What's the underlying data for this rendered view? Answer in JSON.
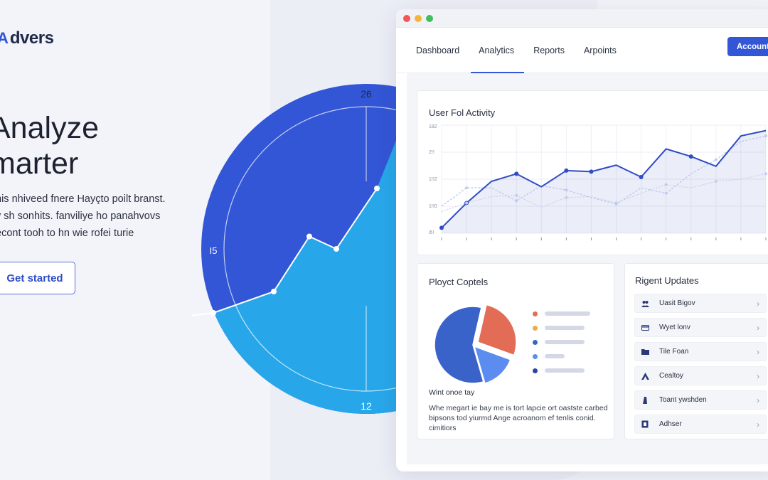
{
  "brand": {
    "logo_mark": "A",
    "logo_text": "dvers"
  },
  "hero": {
    "title_line1": "Analyze",
    "title_line2": "marter",
    "desc_lines": [
      "nis nhiveed fnere Hayçto poilt branst.",
      "y sh sonhits. fanviliye ho panahvovs",
      "econt tooh to hn wie rofei turie"
    ],
    "cta_label": "Get started"
  },
  "gauge": {
    "label_top": "26",
    "label_left": "I5",
    "label_bottom": "12",
    "line_values": [
      0.12,
      0.24,
      0.55,
      0.48,
      0.82
    ]
  },
  "window": {
    "nav_tabs": [
      "Dashboard",
      "Analytics",
      "Reports",
      "Arpoints"
    ],
    "active_tab": "Analytics",
    "account_label": "Account",
    "activity": {
      "title": "User Fol Activity",
      "y_labels": [
        "182",
        "2!!",
        "1!!2",
        "1!!0",
        "i5!"
      ],
      "chart_data": {
        "type": "line",
        "title": "User Fol Activity",
        "series": [
          {
            "values": [
              5,
              28,
              48,
              55,
              43,
              58,
              57,
              63,
              52,
              78,
              71,
              62,
              90,
              95
            ]
          },
          {
            "values": [
              25,
              42,
              42,
              30,
              44,
              40,
              33,
              27,
              42,
              37,
              55,
              68,
              85,
              90
            ]
          },
          {
            "values": [
              20,
              28,
              34,
              35,
              24,
              33,
              34,
              28,
              37,
              45,
              42,
              48,
              50,
              55
            ]
          }
        ]
      }
    },
    "projects": {
      "title": "Ployct Coptels",
      "subtitle": "Wint onoe tay",
      "text_lines": [
        "Whe megart ie bay me is tort lapcie ort oastste carbed",
        "bipsons tod yiurmd Ange acroanom ef tenlis conid.",
        "cimitiors"
      ],
      "chart_data": {
        "type": "pie",
        "values": [
          58,
          27,
          15
        ],
        "colors": [
          "#3a63c9",
          "#e36c57",
          "#5b8cf0"
        ]
      },
      "legend_colors": [
        "#e36c57",
        "#f0a94b",
        "#3a63c9",
        "#5b8cf0",
        "#2a45a6"
      ]
    },
    "updates": {
      "title": "Rigent Updates",
      "items": [
        {
          "icon": "people-icon",
          "label": "Uasit Bigov"
        },
        {
          "icon": "card-icon",
          "label": "Wyet lonv"
        },
        {
          "icon": "folder-icon",
          "label": "Tile Foan"
        },
        {
          "icon": "user-icon",
          "label": "Cealtoy"
        },
        {
          "icon": "user-icon",
          "label": "Toant ywshden"
        },
        {
          "icon": "doc-icon",
          "label": "Adhser"
        }
      ]
    }
  }
}
